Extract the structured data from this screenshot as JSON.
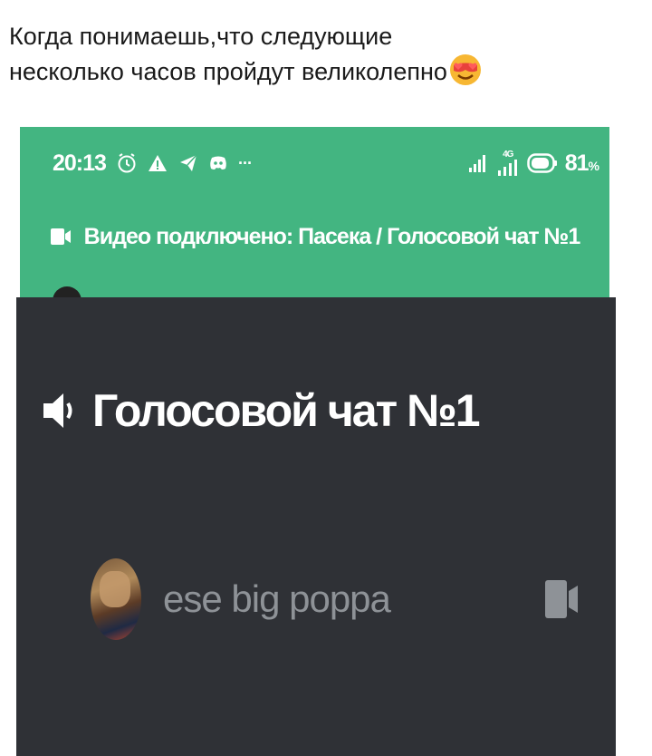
{
  "caption": {
    "line1": "Когда понимаешь,что следующие",
    "line2": "несколько часов пройдут великолепно",
    "emoji": "heart-eyes-sunglasses-emoji"
  },
  "status_bar": {
    "time": "20:13",
    "network_label": "4G",
    "battery": "81",
    "battery_unit": "%",
    "more": "···"
  },
  "banner": {
    "text": "Видео подключено: Пасека / Голосовой чат №1"
  },
  "channel": {
    "name": "Голосовой чат №1"
  },
  "members": [
    {
      "name": "ese big poppa"
    }
  ],
  "colors": {
    "discord_green": "#43b581",
    "panel_dark": "#2f3136",
    "muted_text": "#8e9297"
  }
}
